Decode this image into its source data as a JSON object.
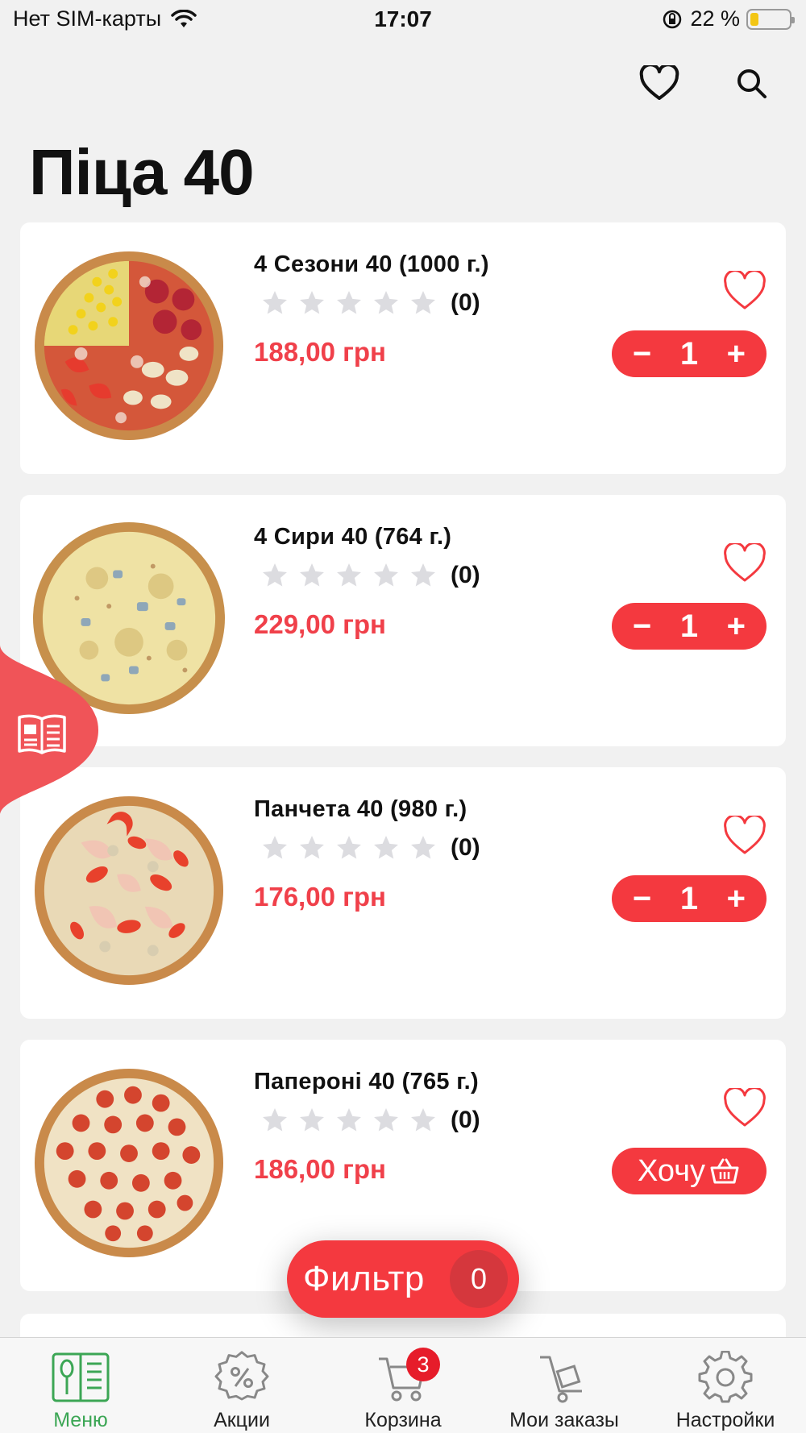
{
  "status_bar": {
    "carrier": "Нет SIM-карты",
    "time": "17:07",
    "battery": "22 %",
    "battery_level": 0.22
  },
  "header": {
    "title": "Піца 40"
  },
  "products": [
    {
      "name": "4 Сезони 40 (1000 г.)",
      "rating_count": "(0)",
      "rating": 0,
      "price": "188,00 грн",
      "quantity": "1",
      "in_cart": true
    },
    {
      "name": "4 Сири 40 (764 г.)",
      "rating_count": "(0)",
      "rating": 0,
      "price": "229,00 грн",
      "quantity": "1",
      "in_cart": true
    },
    {
      "name": "Панчета 40 (980 г.)",
      "rating_count": "(0)",
      "rating": 0,
      "price": "176,00 грн",
      "quantity": "1",
      "in_cart": true
    },
    {
      "name": "Папероні 40 (765 г.)",
      "rating_count": "(0)",
      "rating": 0,
      "price": "186,00 грн",
      "want_label": "Хочу",
      "in_cart": false
    }
  ],
  "stepper": {
    "minus": "−",
    "plus": "+"
  },
  "filter": {
    "label": "Фильтр",
    "count": "0"
  },
  "bottom_nav": {
    "items": [
      {
        "label": "Меню",
        "icon": "menu-book-icon",
        "active": true
      },
      {
        "label": "Акции",
        "icon": "discount-icon"
      },
      {
        "label": "Корзина",
        "icon": "cart-icon",
        "badge": "3"
      },
      {
        "label": "Мои заказы",
        "icon": "orders-icon"
      },
      {
        "label": "Настройки",
        "icon": "settings-icon"
      }
    ]
  },
  "colors": {
    "accent": "#f4393f",
    "price": "#f0404a",
    "active_nav": "#3ca655",
    "background": "#f1f1f1"
  }
}
